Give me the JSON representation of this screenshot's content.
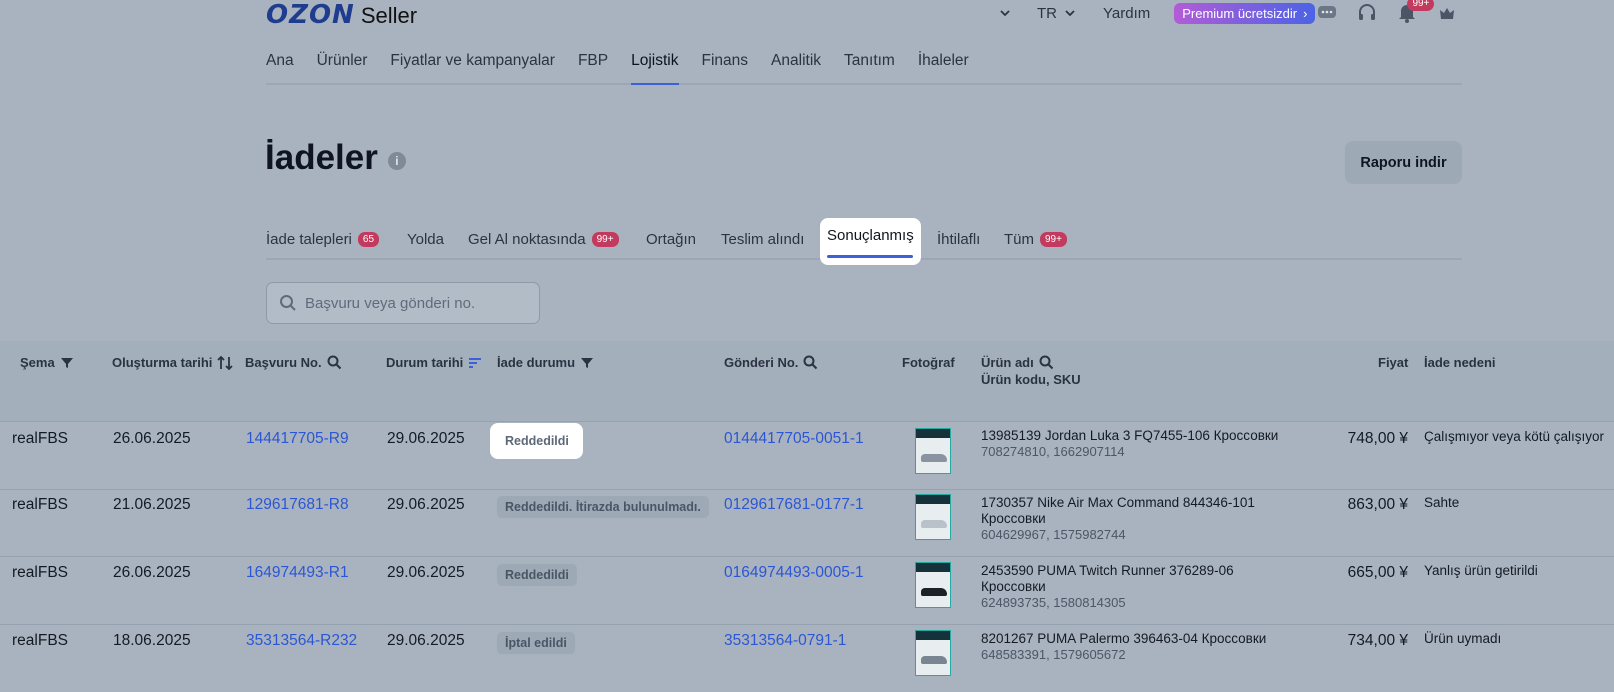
{
  "logo": {
    "brand": "OZON",
    "product": "Seller"
  },
  "topbar": {
    "lang": "TR",
    "help": "Yardım",
    "premium": "Premium ücretsizdir",
    "notif_count": "99+"
  },
  "nav": {
    "items": [
      "Ana",
      "Ürünler",
      "Fiyatlar ve kampanyalar",
      "FBP",
      "Lojistik",
      "Finans",
      "Analitik",
      "Tanıtım",
      "İhaleler"
    ],
    "active": "Lojistik"
  },
  "page": {
    "title": "İadeler",
    "report_button": "Raporu indir"
  },
  "tabs": [
    {
      "label": "İade talepleri",
      "count": "65"
    },
    {
      "label": "Yolda",
      "count": ""
    },
    {
      "label": "Gel Al noktasında",
      "count": "99+"
    },
    {
      "label": "Ortağın",
      "count": ""
    },
    {
      "label": "Teslim alındı",
      "count": ""
    },
    {
      "label": "Sonuçlanmış",
      "count": ""
    },
    {
      "label": "İhtilaflı",
      "count": ""
    },
    {
      "label": "Tüm",
      "count": "99+"
    }
  ],
  "active_tab": "Sonuçlanmış",
  "search": {
    "placeholder": "Başvuru veya gönderi no."
  },
  "table": {
    "headers": {
      "scheme": "Şema",
      "created": "Oluşturma tarihi",
      "app_no": "Başvuru No.",
      "status_date": "Durum tarihi",
      "return_status": "İade durumu",
      "shipment_no": "Gönderi No.",
      "photo": "Fotoğraf",
      "product_name": "Ürün adı",
      "product_code": "Ürün kodu, SKU",
      "price": "Fiyat",
      "reason": "İade nedeni"
    },
    "rows": [
      {
        "scheme": "realFBS",
        "created": "26.06.2025",
        "app_no": "144417705-R9",
        "status_date": "29.06.2025",
        "status": "Reddedildi",
        "shipment": "0144417705-0051-1",
        "name": "13985139 Jordan Luka 3 FQ7455-106 Кроссовки",
        "sku": "708274810, 1662907114",
        "price": "748,00 ¥",
        "reason": "Çalışmıyor veya kötü çalışıyor"
      },
      {
        "scheme": "realFBS",
        "created": "21.06.2025",
        "app_no": "129617681-R8",
        "status_date": "29.06.2025",
        "status": "Reddedildi. İtirazda bulunulmadı.",
        "shipment": "0129617681-0177-1",
        "name": "1730357 Nike Air Max Command 844346-101 Кроссовки",
        "sku": "604629967, 1575982744",
        "price": "863,00 ¥",
        "reason": "Sahte"
      },
      {
        "scheme": "realFBS",
        "created": "26.06.2025",
        "app_no": "164974493-R1",
        "status_date": "29.06.2025",
        "status": "Reddedildi",
        "shipment": "0164974493-0005-1",
        "name": "2453590 PUMA Twitch Runner 376289-06 Кроссовки",
        "sku": "624893735, 1580814305",
        "price": "665,00 ¥",
        "reason": "Yanlış ürün getirildi"
      },
      {
        "scheme": "realFBS",
        "created": "18.06.2025",
        "app_no": "35313564-R232",
        "status_date": "29.06.2025",
        "status": "İptal edildi",
        "shipment": "35313564-0791-1",
        "name": "8201267 PUMA Palermo 396463-04 Кроссовки",
        "sku": "648583391, 1579605672",
        "price": "734,00 ¥",
        "reason": "Ürün uymadı"
      }
    ]
  }
}
